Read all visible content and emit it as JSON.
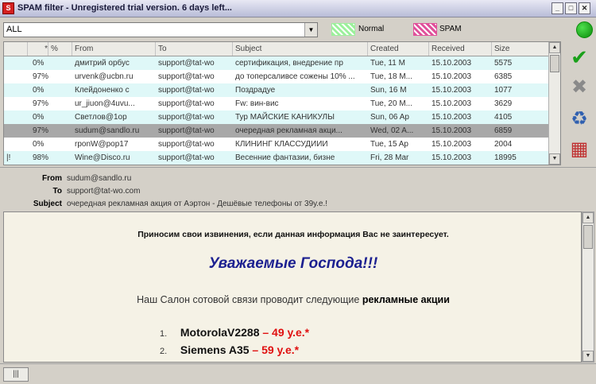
{
  "window": {
    "title": "SPAM filter - Unregistered trial version. 6 days left...",
    "icon_text": "S"
  },
  "toolbar": {
    "filter_value": "ALL",
    "legend": [
      {
        "label": "Normal",
        "color": "#9cf09c"
      },
      {
        "label": "SPAM",
        "color": "#e0509a"
      }
    ],
    "status_color": "#0a8a0a"
  },
  "list": {
    "columns": [
      "*",
      "%",
      "From",
      "To",
      "Subject",
      "Created",
      "Received",
      "Size"
    ],
    "rows": [
      {
        "flag": "",
        "pct": "0%",
        "from": "дмитрий орбус",
        "to": "support@tat-wo",
        "subject": "сертификация, внедрение пр",
        "created": "Tue, 11 M",
        "received": "15.10.2003",
        "size": "5575",
        "bg": "#dff8f8"
      },
      {
        "flag": "",
        "pct": "97%",
        "from": "urvenk@ucbn.ru",
        "to": "support@tat-wo",
        "subject": "до топерсаливсе сожены 10% ...",
        "created": "Tue, 18 M...",
        "received": "15.10.2003",
        "size": "6385",
        "bg": "#ffffff"
      },
      {
        "flag": "",
        "pct": "0%",
        "from": "Клейдоненко с",
        "to": "support@tat-wo",
        "subject": "Поздрадуе",
        "created": "Sun, 16 M",
        "received": "15.10.2003",
        "size": "1077",
        "bg": "#dff8f8"
      },
      {
        "flag": "",
        "pct": "97%",
        "from": "ur_jiuon@4uvu...",
        "to": "support@tat-wo",
        "subject": "Fw: вин-вис",
        "created": "Tue, 20 M...",
        "received": "15.10.2003",
        "size": "3629",
        "bg": "#ffffff"
      },
      {
        "flag": "",
        "pct": "0%",
        "from": "Светлов@1op",
        "to": "support@tat-wo",
        "subject": "Тур МАЙСКИЕ КАНИКУЛЫ",
        "created": "Sun, 06 Ap",
        "received": "15.10.2003",
        "size": "4105",
        "bg": "#dff8f8"
      },
      {
        "flag": "",
        "pct": "97%",
        "from": "sudum@sandlo.ru",
        "to": "support@tat-wo",
        "subject": "очередная рекламная акци...",
        "created": "Wed, 02 A...",
        "received": "15.10.2003",
        "size": "6859",
        "bg": "#a8a8a8"
      },
      {
        "flag": "",
        "pct": "0%",
        "from": "rponW@pop17",
        "to": "support@tat-wo",
        "subject": "КЛИНИНГ КЛАССУДИИИ",
        "created": "Tue, 15 Ap",
        "received": "15.10.2003",
        "size": "2004",
        "bg": "#ffffff"
      },
      {
        "flag": "|!",
        "pct": "98%",
        "from": "Wine@Disco.ru",
        "to": "support@tat-wo",
        "subject": "Весенние фантазии, бизне",
        "created": "Fri, 28 Mar",
        "received": "15.10.2003",
        "size": "18995",
        "bg": "#dff8f8"
      }
    ]
  },
  "tools": [
    {
      "name": "mark-normal",
      "glyph": "✔",
      "color": "#1aa01a"
    },
    {
      "name": "mark-spam",
      "glyph": "✖",
      "color": "#8a8a8a"
    },
    {
      "name": "delete",
      "glyph": "♻",
      "color": "#3060b0"
    },
    {
      "name": "settings",
      "glyph": "▦",
      "color": "#c03030"
    }
  ],
  "message": {
    "from_label": "From",
    "from": "sudum@sandlo.ru",
    "to_label": "To",
    "to": "support@tat-wo.com",
    "subject_label": "Subject",
    "subject": "очередная рекламная акция от Аэртон - Дешёвые телефоны от 39у.е.!",
    "apology": "Приносим свои извинения, если данная информация Вас не заинтересует.",
    "greeting": "Уважаемые Господа!!!",
    "offer_prefix": "Наш Салон сотовой связи проводит следующие",
    "offer_bold": "рекламные акции",
    "promos": [
      {
        "num": "1.",
        "model": "MotorolaV2288",
        "price": " – 49 у.е.*"
      },
      {
        "num": "2.",
        "model": "Siemens A35",
        "price": " – 59 у.е.*"
      }
    ]
  },
  "statusbar": {
    "grip_label": "|||"
  }
}
